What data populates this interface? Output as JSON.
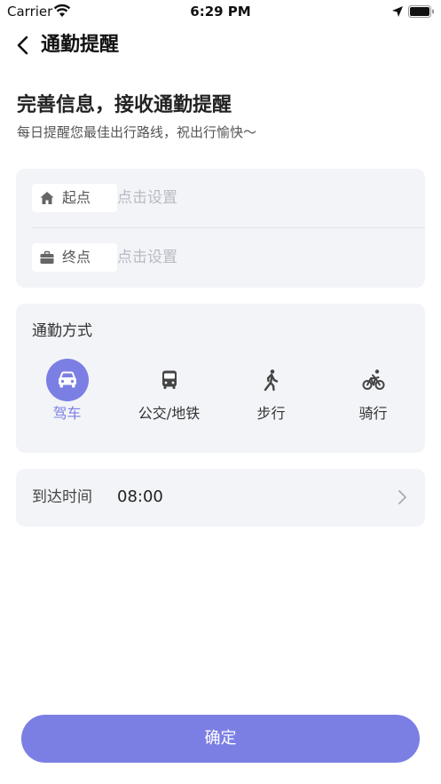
{
  "status_bar": {
    "carrier": "Carrier",
    "time": "6:29 PM"
  },
  "nav": {
    "title": "通勤提醒",
    "back_icon": "chevron-left-icon"
  },
  "intro": {
    "heading": "完善信息，接收通勤提醒",
    "subheading": "每日提醒您最佳出行路线，祝出行愉快～"
  },
  "locations": [
    {
      "label": "起点",
      "icon": "home-icon",
      "value": "点击设置"
    },
    {
      "label": "终点",
      "icon": "briefcase-icon",
      "value": "点击设置"
    }
  ],
  "commute": {
    "title": "通勤方式",
    "modes": [
      {
        "label": "驾车",
        "icon": "car-icon",
        "selected": true
      },
      {
        "label": "公交/地铁",
        "icon": "bus-icon",
        "selected": false
      },
      {
        "label": "步行",
        "icon": "walk-icon",
        "selected": false
      },
      {
        "label": "骑行",
        "icon": "bike-icon",
        "selected": false
      }
    ]
  },
  "arrival": {
    "label": "到达时间",
    "value": "08:00"
  },
  "confirm": {
    "label": "确定"
  },
  "colors": {
    "accent": "#7b7fe4",
    "card_bg": "#f3f4f8",
    "placeholder": "#b8bac2"
  }
}
